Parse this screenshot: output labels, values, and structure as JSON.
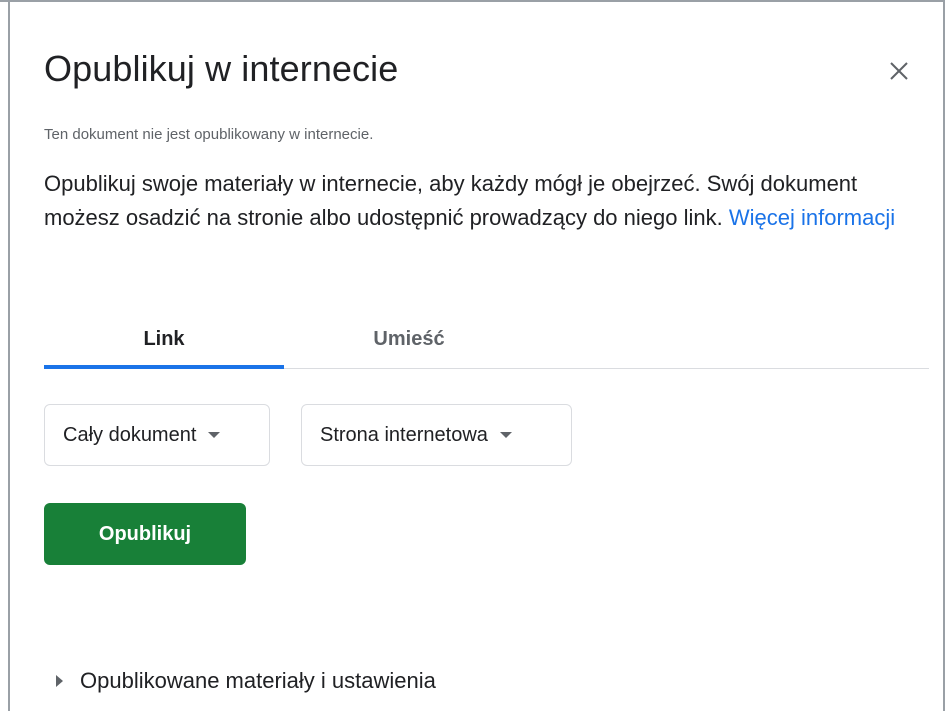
{
  "dialog": {
    "title": "Opublikuj w internecie",
    "status_text": "Ten dokument nie jest opublikowany w internecie.",
    "description": "Opublikuj swoje materiały w internecie, aby każdy mógł je obejrzeć. Swój dokument możesz osadzić na stronie albo udostępnić prowadzący do niego link.",
    "learn_more_link": "Więcej informacji"
  },
  "tabs": [
    {
      "label": "Link",
      "active": true
    },
    {
      "label": "Umieść",
      "active": false
    }
  ],
  "selects": {
    "scope": {
      "value": "Cały dokument"
    },
    "format": {
      "value": "Strona internetowa"
    }
  },
  "publish_button": {
    "label": "Opublikuj"
  },
  "published_section": {
    "label": "Opublikowane materiały i ustawienia"
  },
  "colors": {
    "accent": "#1a73e8",
    "publish_green": "#188038",
    "muted_text": "#5f6368"
  },
  "icons": {
    "close": "close-icon",
    "dropdown": "caret-down-icon",
    "expand": "triangle-right-icon"
  }
}
